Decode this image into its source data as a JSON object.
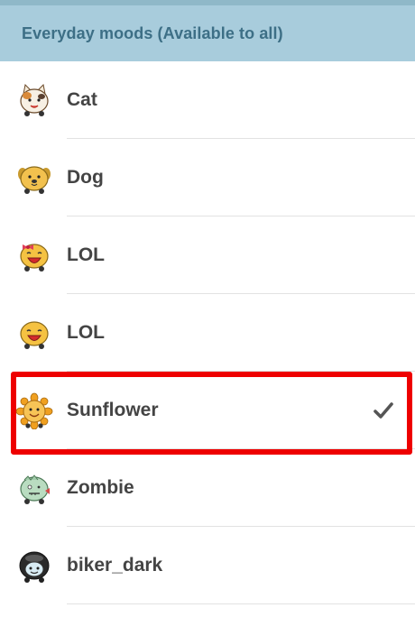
{
  "header": {
    "title": "Everyday moods (Available to all)"
  },
  "moods": [
    {
      "label": "Cat",
      "icon": "cat-mood-icon",
      "selected": false
    },
    {
      "label": "Dog",
      "icon": "dog-mood-icon",
      "selected": false
    },
    {
      "label": "LOL",
      "icon": "lol-bow-mood-icon",
      "selected": false
    },
    {
      "label": "LOL",
      "icon": "lol-mood-icon",
      "selected": false
    },
    {
      "label": "Sunflower",
      "icon": "sunflower-mood-icon",
      "selected": true
    },
    {
      "label": "Zombie",
      "icon": "zombie-mood-icon",
      "selected": false
    },
    {
      "label": "biker_dark",
      "icon": "biker-dark-mood-icon",
      "selected": false
    }
  ],
  "colors": {
    "header_bg": "#a8ccdc",
    "header_text": "#3d6f86",
    "highlight": "#ee0000",
    "label_text": "#444444"
  }
}
